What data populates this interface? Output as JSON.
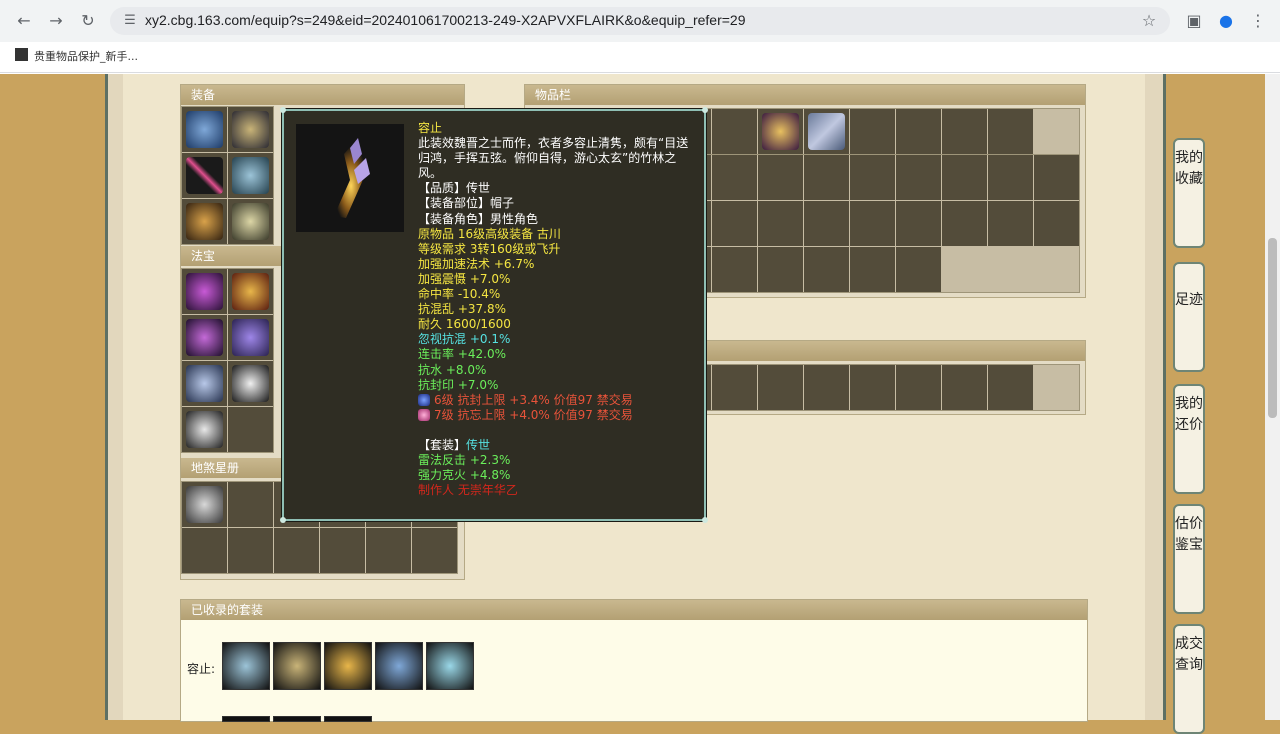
{
  "browser": {
    "url": "xy2.cbg.163.com/equip?s=249&eid=202401061700213-249-X2APVXFLAIRK&o&equip_refer=29",
    "bookmark": "贵重物品保护_新手..."
  },
  "sections": {
    "equipment": "装备",
    "fabao": "法宝",
    "disha": "地煞星册",
    "inventory": "物品栏",
    "collected": "已收录的套装"
  },
  "collected": {
    "set_label": "容止:"
  },
  "side_tabs": [
    "我的收藏",
    "足迹",
    "我的还价",
    "估价鉴宝",
    "成交查询"
  ],
  "tooltip": {
    "name": "容止",
    "description": "此装效魏晋之士而作，衣者多容止清隽，颇有“目送归鸿，手挥五弦。俯仰自得，游心太玄”的竹林之风。",
    "quality": "【品质】传世",
    "slot": "【装备部位】帽子",
    "role": "【装备角色】男性角色",
    "origin": "原物品 16级高级装备 古川",
    "level_req": "等级需求 3转160级或飞升",
    "stats_yellow": [
      "加强加速法术 +6.7%",
      "加强震慑 +7.0%",
      "命中率 -10.4%",
      "抗混乱 +37.8%",
      "耐久 1600/1600"
    ],
    "stat_cyan": "忽视抗混 +0.1%",
    "stats_green": [
      "连击率 +42.0%",
      "抗水 +8.0%",
      "抗封印 +7.0%"
    ],
    "gems": [
      "6级 抗封上限 +3.4% 价值97 禁交易",
      "7级 抗忘上限 +4.0% 价值97 禁交易"
    ],
    "set_prefix": "【套装】",
    "set_name": "传世",
    "set_stats": [
      "雷法反击 +2.3%",
      "强力克火 +4.8%"
    ],
    "maker": "制作人 无崇年华乙"
  }
}
